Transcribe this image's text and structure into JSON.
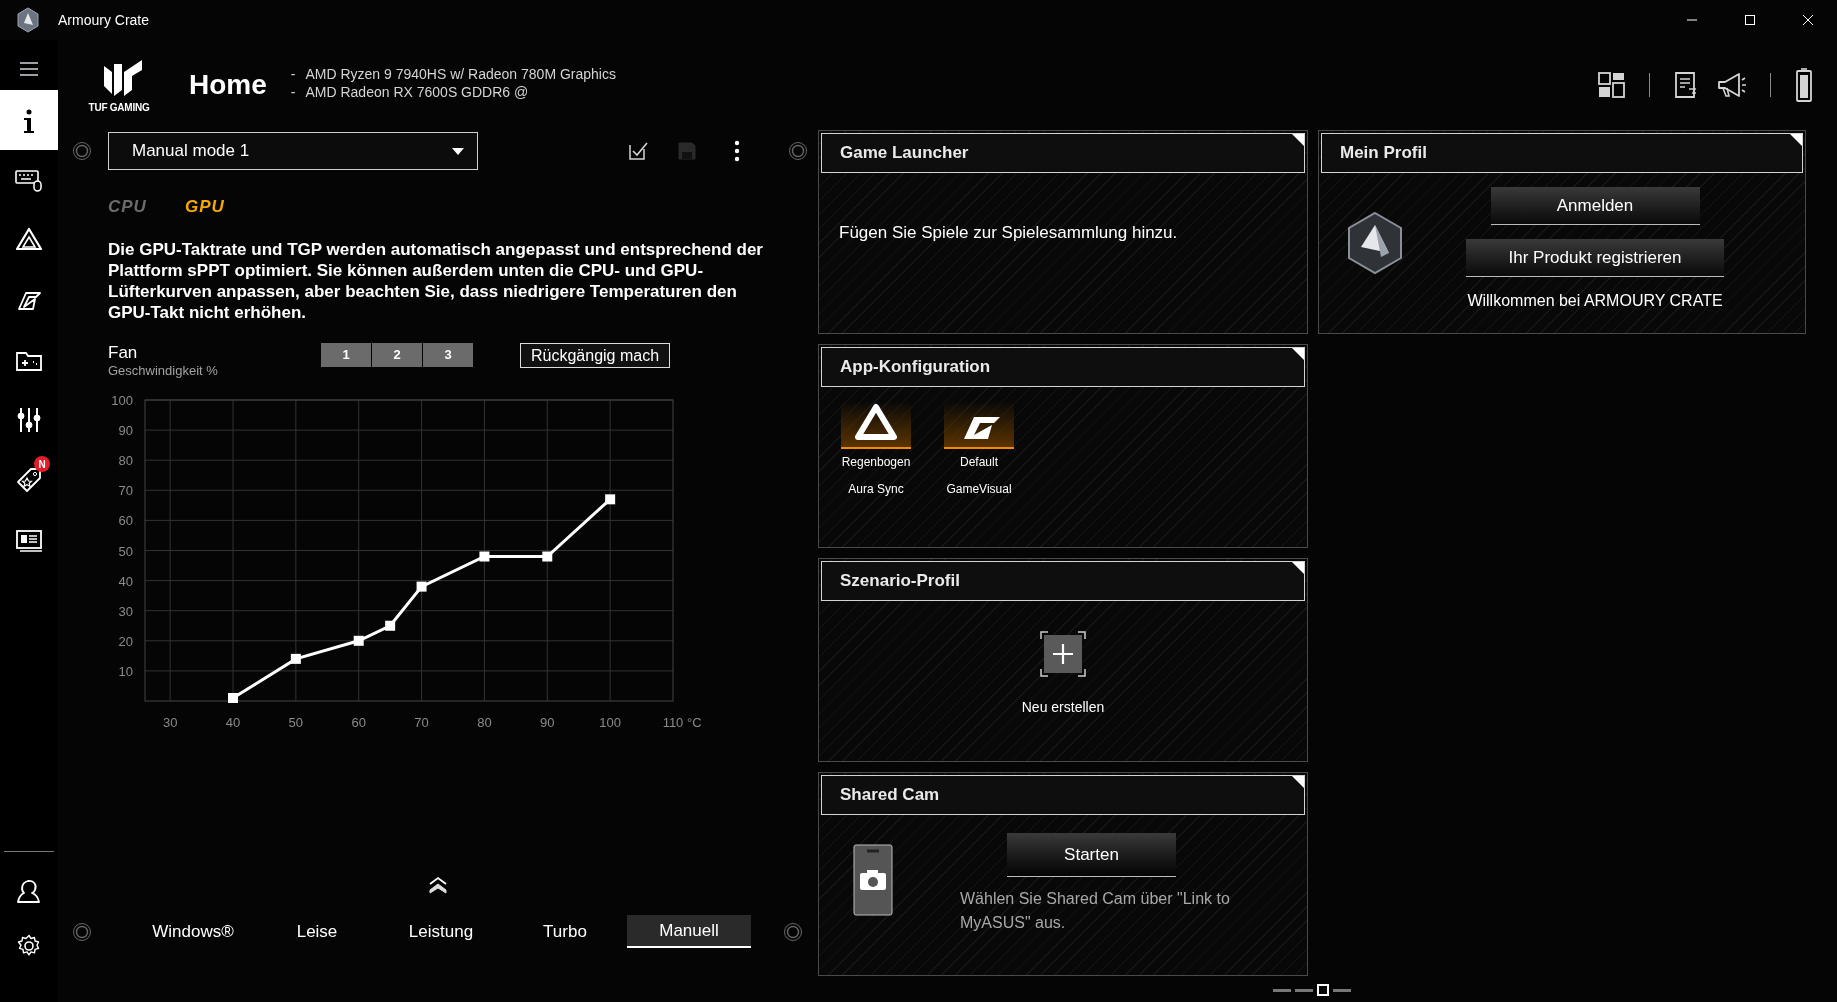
{
  "window": {
    "title": "Armoury Crate"
  },
  "sidebar": {
    "items": [
      {
        "selected": true
      },
      {
        "selected": false
      },
      {
        "selected": false
      },
      {
        "selected": false
      },
      {
        "selected": false
      },
      {
        "selected": false
      },
      {
        "selected": false,
        "badge": "N"
      },
      {
        "selected": false
      }
    ]
  },
  "header": {
    "brand": "TUF GAMING",
    "title": "Home",
    "specs": [
      {
        "bullet": "-",
        "text": "AMD Ryzen 9 7940HS w/ Radeon 780M Graphics"
      },
      {
        "bullet": "-",
        "text": "AMD Radeon RX 7600S GDDR6 @"
      }
    ]
  },
  "fan_panel": {
    "mode_select": {
      "value": "Manual mode 1"
    },
    "device_tabs": [
      {
        "label": "CPU",
        "selected": false
      },
      {
        "label": "GPU",
        "selected": true
      }
    ],
    "description": "Die GPU-Taktrate und TGP werden automatisch angepasst und entsprechend der Plattform sPPT optimiert. Sie können außerdem unten die CPU- und GPU-Lüfterkurven anpassen, aber beachten Sie, dass niedrigere Temperaturen den GPU-Takt nicht erhöhen.",
    "fan": {
      "curve_tabs": [
        {
          "label": "1"
        },
        {
          "label": "2"
        },
        {
          "label": "3"
        }
      ],
      "undo_button": "Rückgängig mach",
      "chart_data": {
        "type": "line",
        "xlabel": "°C",
        "ylabel": "Geschwindigkeit %",
        "x": [
          40,
          50,
          60,
          65,
          70,
          80,
          90,
          100
        ],
        "grid": true,
        "series": [
          {
            "name": "Fan",
            "color": "#ffffff",
            "marker": "square",
            "values": [
              1,
              14,
              20,
              25,
              38,
              48,
              48,
              67
            ]
          }
        ],
        "xlim": [
          26,
          110
        ],
        "ylim": [
          0,
          100
        ],
        "xticks": [
          30,
          40,
          50,
          60,
          70,
          80,
          90,
          100,
          110
        ],
        "yticks": [
          10,
          20,
          30,
          40,
          50,
          60,
          70,
          80,
          90,
          100
        ]
      }
    }
  },
  "modes": [
    {
      "label": "Windows®",
      "selected": false
    },
    {
      "label": "Leise",
      "selected": false
    },
    {
      "label": "Leistung",
      "selected": false
    },
    {
      "label": "Turbo",
      "selected": false
    },
    {
      "label": "Manuell",
      "selected": true
    }
  ],
  "cards": {
    "game_launcher": {
      "title": "Game Launcher",
      "message": "Fügen Sie Spiele zur Spielesammlung hinzu."
    },
    "profile": {
      "title": "Mein Profil",
      "buttons": [
        "Anmelden",
        "Ihr Produkt registrieren"
      ],
      "welcome": "Willkommen bei ARMOURY CRATE"
    },
    "app_config": {
      "title": "App-Konfiguration",
      "apps": [
        {
          "value": "Regenbogen",
          "name": "Aura Sync"
        },
        {
          "value": "Default",
          "name": "GameVisual"
        }
      ]
    },
    "scenario": {
      "title": "Szenario-Profil",
      "create_label": "Neu erstellen"
    },
    "shared_cam": {
      "title": "Shared Cam",
      "button": "Starten",
      "hint": "Wählen Sie Shared Cam über \"Link to MyASUS\" aus."
    }
  },
  "pager": [
    {
      "selected": false
    },
    {
      "selected": false
    },
    {
      "selected": true
    },
    {
      "selected": false
    }
  ]
}
